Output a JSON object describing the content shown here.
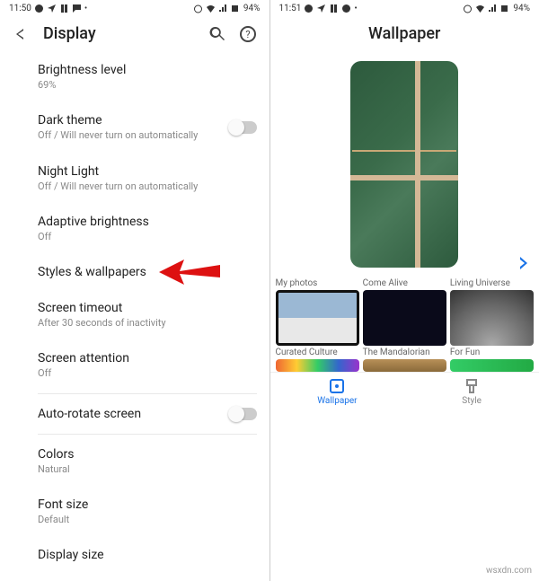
{
  "left": {
    "status": {
      "time": "11:50",
      "battery": "94%"
    },
    "header": {
      "title": "Display"
    },
    "items": [
      {
        "label": "Brightness level",
        "sub": "69%"
      },
      {
        "label": "Dark theme",
        "sub": "Off / Will never turn on automatically",
        "toggle": true
      },
      {
        "label": "Night Light",
        "sub": "Off / Will never turn on automatically"
      },
      {
        "label": "Adaptive brightness",
        "sub": "Off"
      },
      {
        "label": "Styles & wallpapers",
        "sub": ""
      },
      {
        "label": "Screen timeout",
        "sub": "After 30 seconds of inactivity"
      },
      {
        "label": "Screen attention",
        "sub": "Off"
      },
      {
        "label": "Auto-rotate screen",
        "sub": "",
        "toggle": true
      },
      {
        "label": "Colors",
        "sub": "Natural"
      },
      {
        "label": "Font size",
        "sub": "Default"
      },
      {
        "label": "Display size",
        "sub": ""
      }
    ]
  },
  "right": {
    "status": {
      "time": "11:51",
      "battery": "94%"
    },
    "header": {
      "title": "Wallpaper"
    },
    "categories": [
      {
        "label": "My photos"
      },
      {
        "label": "Come Alive"
      },
      {
        "label": "Living Universe"
      },
      {
        "label": "Curated Culture"
      },
      {
        "label": "The Mandalorian"
      },
      {
        "label": "For Fun"
      }
    ],
    "tabs": {
      "wallpaper": "Wallpaper",
      "style": "Style"
    }
  },
  "watermark": "wsxdn.com"
}
